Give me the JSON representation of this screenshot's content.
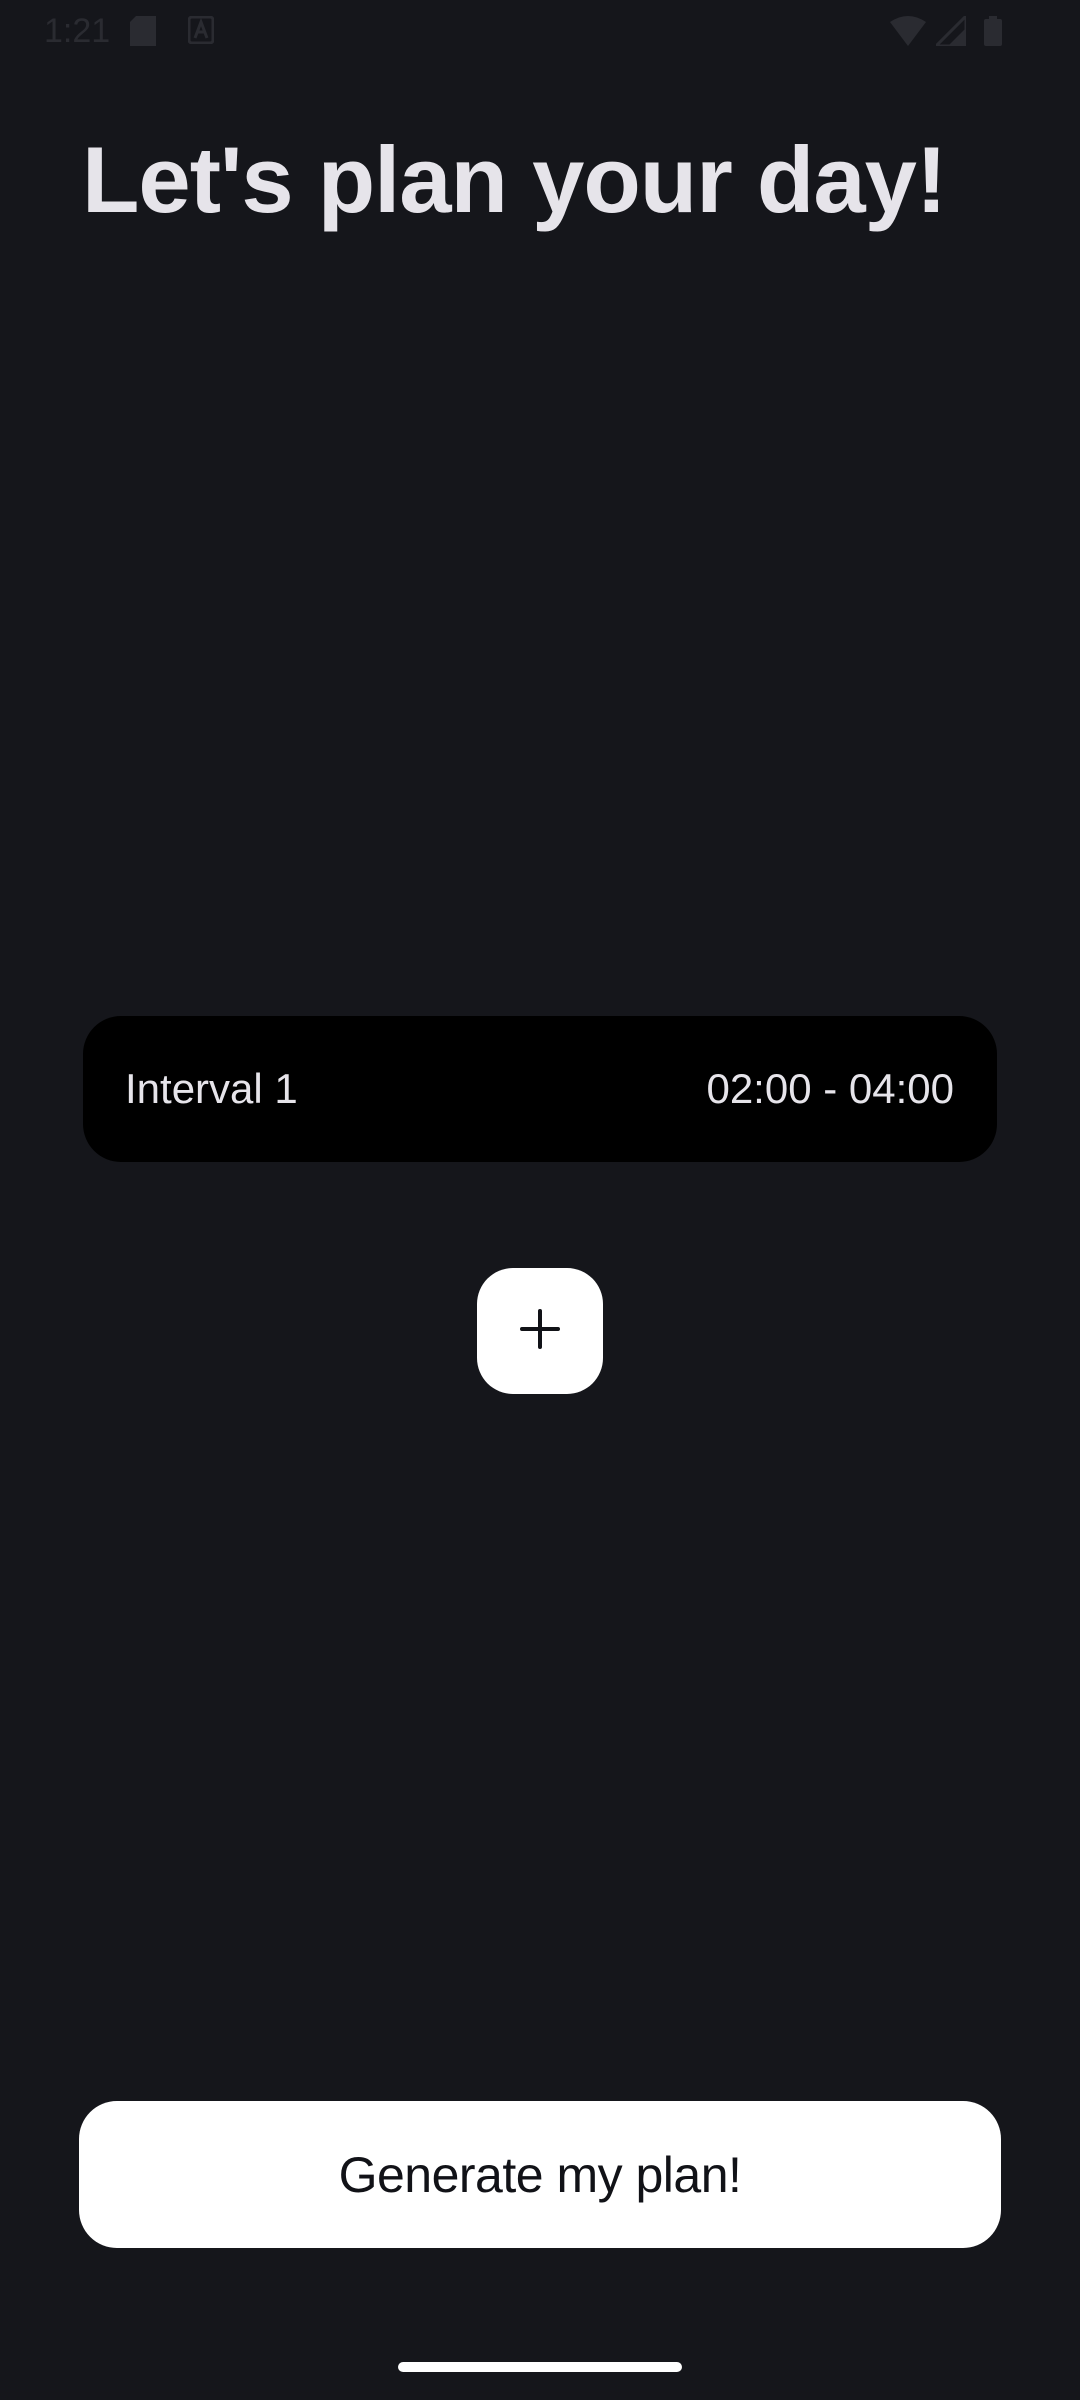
{
  "status_bar": {
    "time": "1:21",
    "icons": [
      "sd-card-icon",
      "a-badge-icon",
      "wifi-icon",
      "signal-icon",
      "battery-icon"
    ]
  },
  "header": {
    "title": "Let's plan your day!"
  },
  "intervals": [
    {
      "label": "Interval 1",
      "range": "02:00 - 04:00"
    }
  ],
  "actions": {
    "add_icon": "plus-icon",
    "generate_label": "Generate my plan!"
  },
  "colors": {
    "background": "#15161b",
    "card": "#000000",
    "button": "#ffffff",
    "text_light": "#e6e4ea",
    "text_dark": "#111217"
  }
}
